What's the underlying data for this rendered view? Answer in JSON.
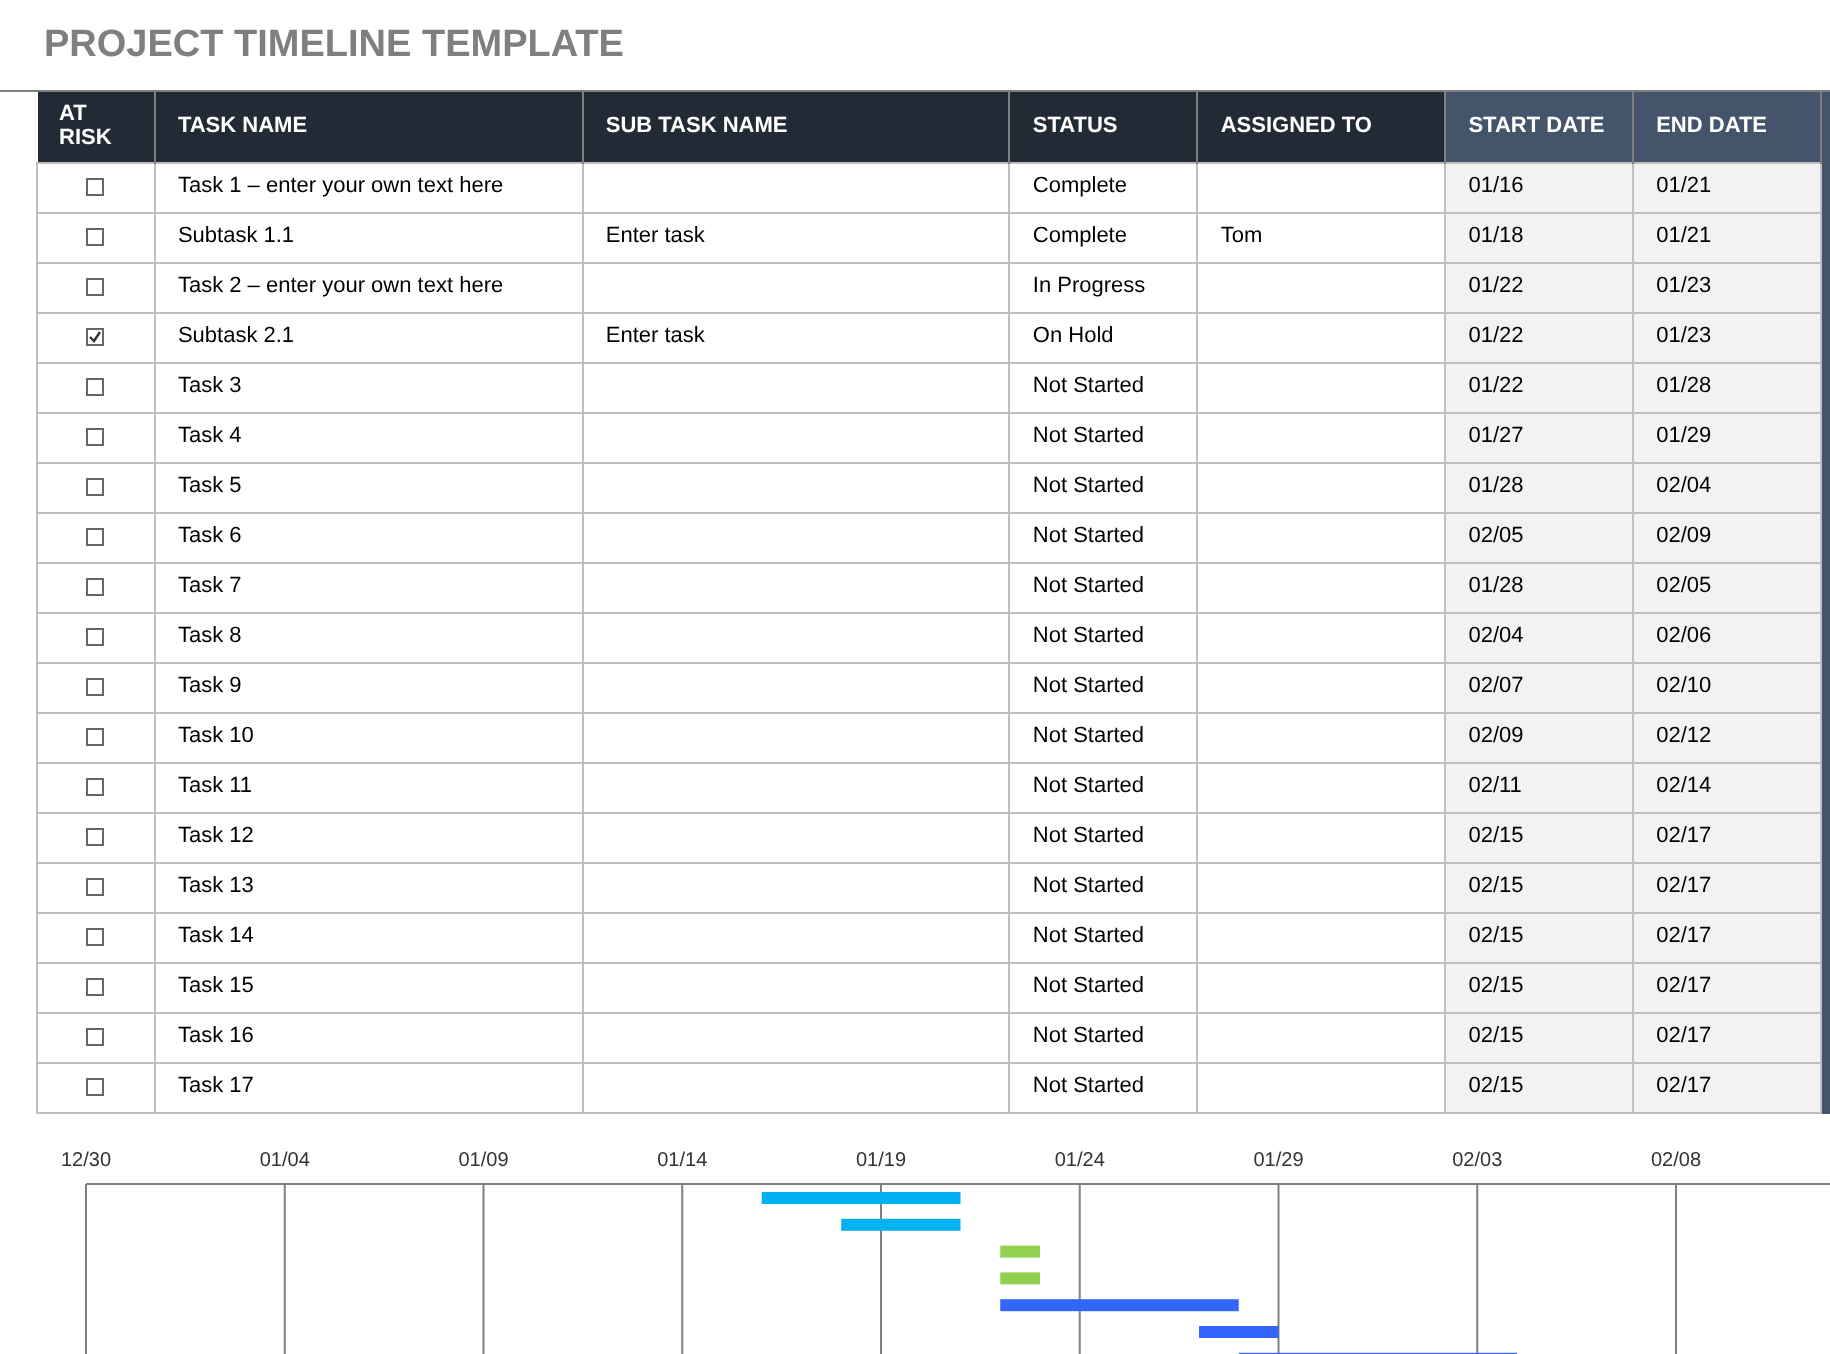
{
  "title": "PROJECT TIMELINE TEMPLATE",
  "table": {
    "columns": [
      {
        "label": "AT RISK",
        "kind": "check"
      },
      {
        "label": "TASK NAME",
        "kind": "text"
      },
      {
        "label": "SUB TASK NAME",
        "kind": "text"
      },
      {
        "label": "STATUS",
        "kind": "text"
      },
      {
        "label": "ASSIGNED TO",
        "kind": "text"
      },
      {
        "label": "START DATE",
        "kind": "date"
      },
      {
        "label": "END DATE",
        "kind": "date"
      }
    ],
    "rows": [
      {
        "at_risk": false,
        "task": "Task 1 – enter your own text here",
        "subtask": "",
        "status": "Complete",
        "assigned": "",
        "start": "01/16",
        "end": "01/21",
        "color": "#00b0f0"
      },
      {
        "at_risk": false,
        "task": "Subtask 1.1",
        "subtask": "Enter task",
        "status": "Complete",
        "assigned": "Tom",
        "start": "01/18",
        "end": "01/21",
        "color": "#00b0f0"
      },
      {
        "at_risk": false,
        "task": "Task 2 – enter your own text here",
        "subtask": "",
        "status": "In Progress",
        "assigned": "",
        "start": "01/22",
        "end": "01/23",
        "color": "#92d050"
      },
      {
        "at_risk": true,
        "task": "Subtask 2.1",
        "subtask": "Enter task",
        "status": "On Hold",
        "assigned": "",
        "start": "01/22",
        "end": "01/23",
        "color": "#92d050"
      },
      {
        "at_risk": false,
        "task": "Task 3",
        "subtask": "",
        "status": "Not Started",
        "assigned": "",
        "start": "01/22",
        "end": "01/28",
        "color": "#3366ff"
      },
      {
        "at_risk": false,
        "task": "Task 4",
        "subtask": "",
        "status": "Not Started",
        "assigned": "",
        "start": "01/27",
        "end": "01/29",
        "color": "#3366ff"
      },
      {
        "at_risk": false,
        "task": "Task 5",
        "subtask": "",
        "status": "Not Started",
        "assigned": "",
        "start": "01/28",
        "end": "02/04",
        "color": "#3366ff"
      },
      {
        "at_risk": false,
        "task": "Task 6",
        "subtask": "",
        "status": "Not Started",
        "assigned": "",
        "start": "02/05",
        "end": "02/09"
      },
      {
        "at_risk": false,
        "task": "Task 7",
        "subtask": "",
        "status": "Not Started",
        "assigned": "",
        "start": "01/28",
        "end": "02/05"
      },
      {
        "at_risk": false,
        "task": "Task 8",
        "subtask": "",
        "status": "Not Started",
        "assigned": "",
        "start": "02/04",
        "end": "02/06"
      },
      {
        "at_risk": false,
        "task": "Task 9",
        "subtask": "",
        "status": "Not Started",
        "assigned": "",
        "start": "02/07",
        "end": "02/10"
      },
      {
        "at_risk": false,
        "task": "Task 10",
        "subtask": "",
        "status": "Not Started",
        "assigned": "",
        "start": "02/09",
        "end": "02/12"
      },
      {
        "at_risk": false,
        "task": "Task 11",
        "subtask": "",
        "status": "Not Started",
        "assigned": "",
        "start": "02/11",
        "end": "02/14"
      },
      {
        "at_risk": false,
        "task": "Task 12",
        "subtask": "",
        "status": "Not Started",
        "assigned": "",
        "start": "02/15",
        "end": "02/17"
      },
      {
        "at_risk": false,
        "task": "Task 13",
        "subtask": "",
        "status": "Not Started",
        "assigned": "",
        "start": "02/15",
        "end": "02/17"
      },
      {
        "at_risk": false,
        "task": "Task 14",
        "subtask": "",
        "status": "Not Started",
        "assigned": "",
        "start": "02/15",
        "end": "02/17"
      },
      {
        "at_risk": false,
        "task": "Task 15",
        "subtask": "",
        "status": "Not Started",
        "assigned": "",
        "start": "02/15",
        "end": "02/17"
      },
      {
        "at_risk": false,
        "task": "Task 16",
        "subtask": "",
        "status": "Not Started",
        "assigned": "",
        "start": "02/15",
        "end": "02/17"
      },
      {
        "at_risk": false,
        "task": "Task 17",
        "subtask": "",
        "status": "Not Started",
        "assigned": "",
        "start": "02/15",
        "end": "02/17"
      }
    ]
  },
  "timeline": {
    "ticks": [
      "12/30",
      "01/04",
      "01/09",
      "01/14",
      "01/19",
      "01/24",
      "01/29",
      "02/03",
      "02/08"
    ]
  }
}
